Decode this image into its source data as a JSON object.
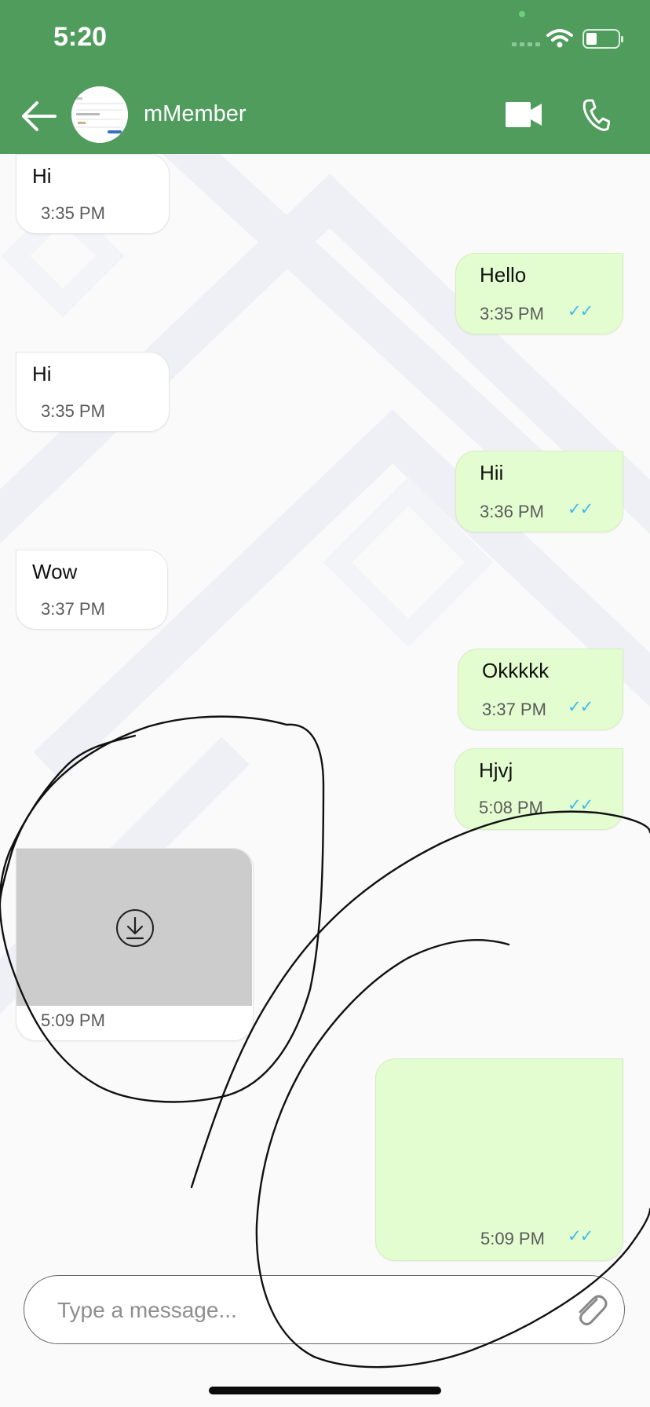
{
  "status_bar": {
    "time": "5:20"
  },
  "header": {
    "contact_name": "mMember"
  },
  "messages": [
    {
      "direction": "in",
      "text": "Hi",
      "time": "3:35 PM"
    },
    {
      "direction": "out",
      "text": "Hello",
      "time": "3:35 PM",
      "ticks": "✓✓"
    },
    {
      "direction": "in",
      "text": "Hi",
      "time": "3:35 PM"
    },
    {
      "direction": "out",
      "text": "Hii",
      "time": "3:36 PM",
      "ticks": "✓✓"
    },
    {
      "direction": "in",
      "text": "Wow",
      "time": "3:37 PM"
    },
    {
      "direction": "out",
      "text": "Okkkkk",
      "time": "3:37 PM",
      "ticks": "✓✓"
    },
    {
      "direction": "out",
      "text": "Hjvj",
      "time": "5:08 PM",
      "ticks": "✓✓"
    },
    {
      "direction": "in",
      "type": "media",
      "time": "5:09 PM"
    },
    {
      "direction": "out",
      "type": "media",
      "time": "5:09 PM",
      "ticks": "✓✓"
    }
  ],
  "composer": {
    "placeholder": "Type a message..."
  },
  "colors": {
    "header": "#4f9c5d",
    "outgoing_bubble": "#e3fdd0",
    "incoming_bubble": "#ffffff",
    "ticks": "#3fb8ee"
  }
}
